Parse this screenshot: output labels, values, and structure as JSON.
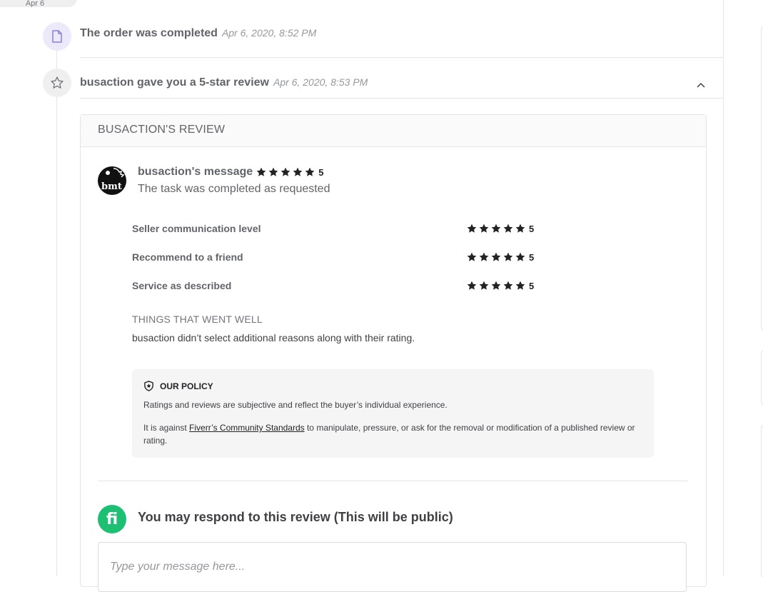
{
  "timeline": {
    "date_pill": "Apr 6",
    "events": [
      {
        "title": "The order was completed",
        "date": "Apr 6, 2020, 8:52 PM",
        "icon": "document-icon"
      },
      {
        "title": "busaction gave you a 5-star review",
        "date": "Apr 6, 2020, 8:53 PM",
        "icon": "star-outline-icon"
      }
    ]
  },
  "review": {
    "header": "BUSACTION'S REVIEW",
    "avatar_text": "bmt",
    "message_label": "busaction's message",
    "overall_rating": "5",
    "message": "The task was completed as requested",
    "criteria": [
      {
        "label": "Seller communication level",
        "rating": "5"
      },
      {
        "label": "Recommend to a friend",
        "rating": "5"
      },
      {
        "label": "Service as described",
        "rating": "5"
      }
    ],
    "went_well_title": "THINGS THAT WENT WELL",
    "went_well_text": "busaction didn’t select additional reasons along with their rating."
  },
  "policy": {
    "title": "OUR POLICY",
    "p1": "Ratings and reviews are subjective and reflect the buyer’s individual experience.",
    "p2_before": "It is against ",
    "p2_link": "Fiverr’s Community Standards",
    "p2_after": " to manipulate, pressure, or ask for the removal or modification of a published review or rating."
  },
  "respond": {
    "logo": "fi",
    "title": "You may respond to this review (This will be public)",
    "placeholder": "Type your message here..."
  },
  "colors": {
    "accent_green": "#1dbf73",
    "icon_bg_purple": "#ece9fb",
    "icon_bg_grey": "#efeff0",
    "star_color": "#222325"
  }
}
